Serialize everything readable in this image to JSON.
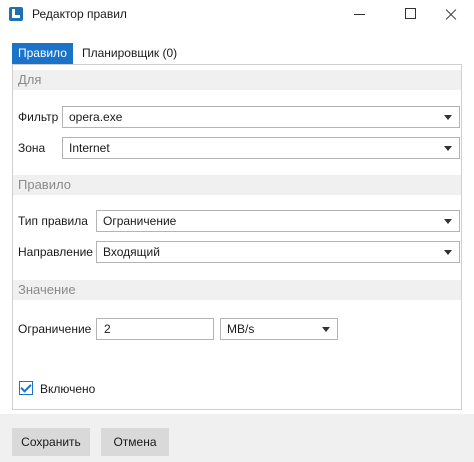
{
  "window": {
    "title": "Редактор правил"
  },
  "tabs": [
    {
      "label": "Правило"
    },
    {
      "label": "Планировщик (0)"
    }
  ],
  "sections": {
    "for": "Для",
    "rule": "Правило",
    "value": "Значение"
  },
  "fields": {
    "filter": {
      "label": "Фильтр",
      "value": "opera.exe"
    },
    "zone": {
      "label": "Зона",
      "value": "Internet"
    },
    "rule_type": {
      "label": "Тип правила",
      "value": "Ограничение"
    },
    "direction": {
      "label": "Направление",
      "value": "Входящий"
    },
    "limit": {
      "label": "Ограничение",
      "value": "2",
      "unit": "MB/s"
    }
  },
  "enabled": {
    "label": "Включено",
    "checked": true
  },
  "buttons": {
    "save": "Сохранить",
    "cancel": "Отмена"
  },
  "icons": {
    "app": "netlimiter-app-icon",
    "minimize": "minimize-icon",
    "maximize": "maximize-icon",
    "close": "close-icon"
  },
  "colors": {
    "accent": "#1a73c9",
    "section_bg": "#f0f0f0",
    "button_bg": "#d9d9d9"
  }
}
